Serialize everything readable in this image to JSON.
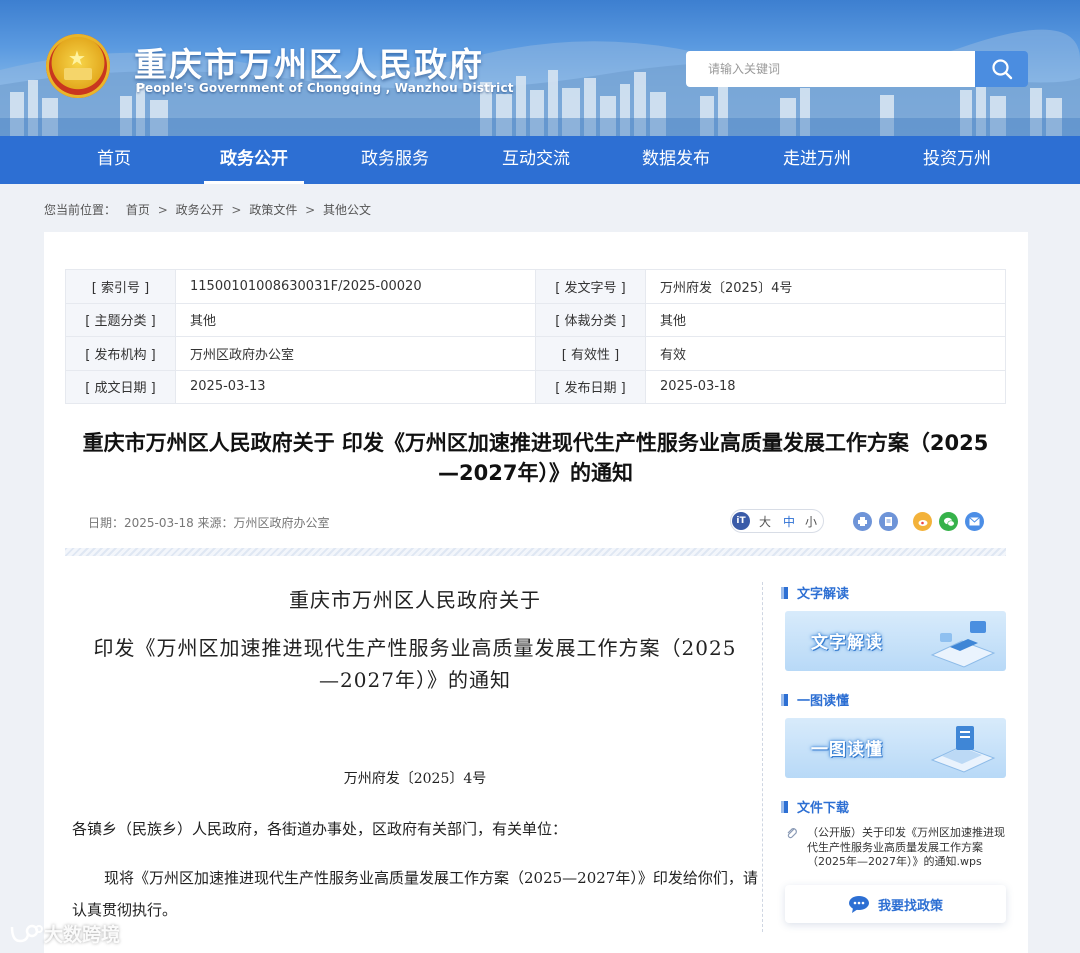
{
  "header": {
    "title": "重庆市万州区人民政府",
    "subtitle": "People's Government of Chongqing , Wanzhou District",
    "search_placeholder": "请输入关键词"
  },
  "nav": [
    "首页",
    "政务公开",
    "政务服务",
    "互动交流",
    "数据发布",
    "走进万州",
    "投资万州"
  ],
  "nav_active": "政务公开",
  "breadcrumb": {
    "prefix": "您当前位置：",
    "items": [
      "首页",
      "政务公开",
      "政策文件",
      "其他公文"
    ],
    "sep": ">"
  },
  "meta": {
    "index_label": "[ 索引号 ]",
    "index_value": "11500101008630031F/2025-00020",
    "docno_label": "[ 发文字号 ]",
    "docno_value": "万州府发〔2025〕4号",
    "topic_label": "[ 主题分类 ]",
    "topic_value": "其他",
    "genre_label": "[ 体裁分类 ]",
    "genre_value": "其他",
    "issuer_label": "[ 发布机构 ]",
    "issuer_value": "万州区政府办公室",
    "validity_label": "[ 有效性 ]",
    "validity_value": "有效",
    "written_label": "[ 成文日期 ]",
    "written_value": "2025-03-13",
    "published_label": "[ 发布日期 ]",
    "published_value": "2025-03-18"
  },
  "doc": {
    "title_line1": "重庆市万州区人民政府关于 印发《万州区加速推进现代生产性服务业高质量发展工作方案（2025",
    "title_line2": "—2027年）》的通知",
    "info": "日期：2025-03-18   来源：万州区政府办公室",
    "font_large": "大",
    "font_medium": "中",
    "font_small": "小",
    "font_icon": "iT"
  },
  "body": {
    "heading1": "重庆市万州区人民政府关于",
    "heading2_line1": "印发《万州区加速推进现代生产性服务业高质量发展工作方案（2025",
    "heading2_line2": "—2027年）》的通知",
    "doc_number": "万州府发〔2025〕4号",
    "addressee": "各镇乡（民族乡）人民政府，各街道办事处，区政府有关部门，有关单位：",
    "paragraph": "现将《万州区加速推进现代生产性服务业高质量发展工作方案（2025—2027年）》印发给你们，请认真贯彻执行。"
  },
  "sidebar": {
    "text_interp_heading": "文字解读",
    "text_interp_banner": "文字解读",
    "graphic_heading": "一图读懂",
    "graphic_banner": "一图读懂",
    "download_heading": "文件下载",
    "download_file": "（公开版）关于印发《万州区加速推进现代生产性服务业高质量发展工作方案（2025年—2027年）》的通知.wps",
    "find_policy": "我要找政策"
  },
  "watermark": "大数跨境",
  "colors": {
    "primary": "#2d6fd3",
    "nav_bg": "#2d6fd3",
    "page_bg": "#eef1f6"
  }
}
